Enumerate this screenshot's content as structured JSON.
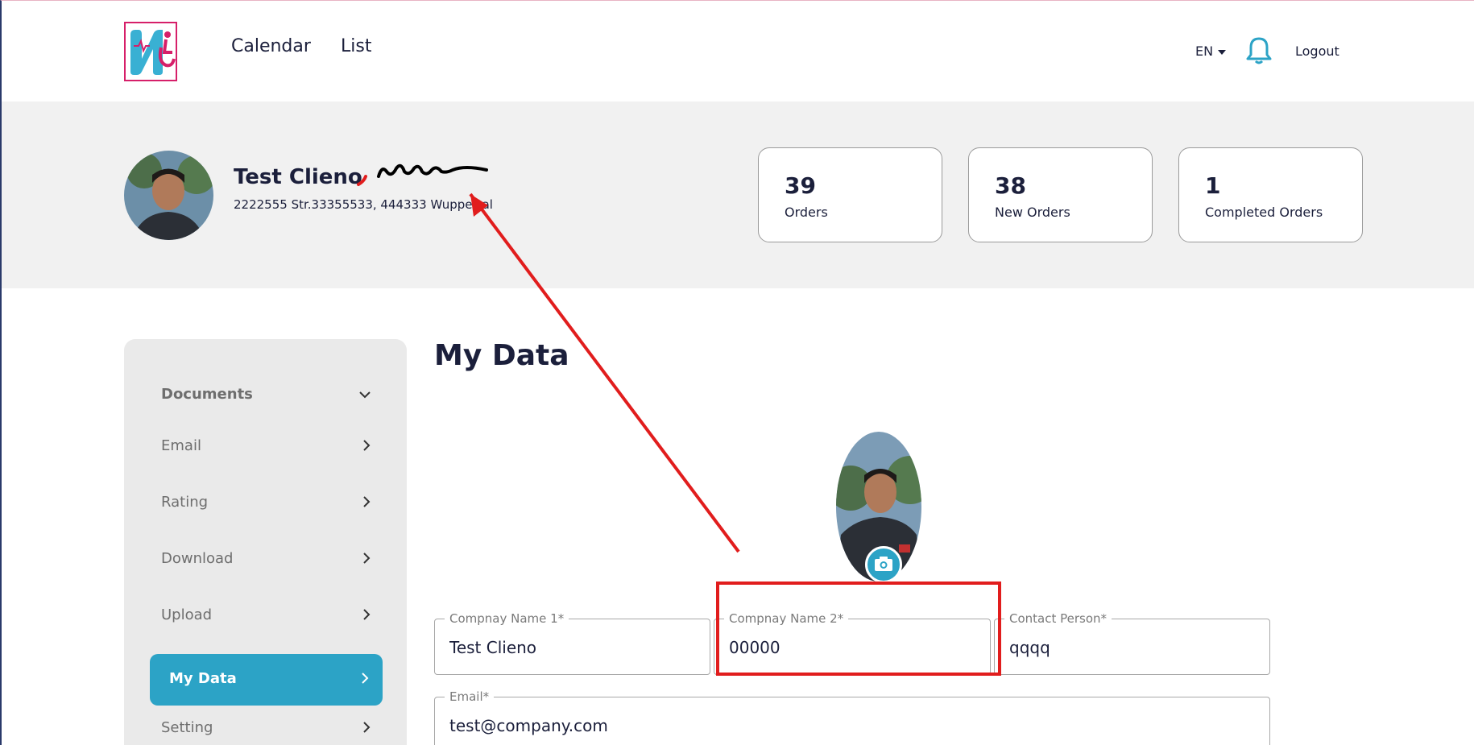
{
  "header": {
    "nav": [
      {
        "label": "Calendar"
      },
      {
        "label": "List"
      }
    ],
    "language": "EN",
    "logout_label": "Logout"
  },
  "profile": {
    "name": "Test Clieno",
    "address": "2222555 Str.33355533, 444333 Wuppertal"
  },
  "stats": [
    {
      "value": "39",
      "label": "Orders"
    },
    {
      "value": "38",
      "label": "New Orders"
    },
    {
      "value": "1",
      "label": "Completed Orders"
    }
  ],
  "sidebar": {
    "items": [
      {
        "label": "Documents",
        "chevron": "chevron-down"
      },
      {
        "label": "Email",
        "chevron": "chevron-right"
      },
      {
        "label": "Rating",
        "chevron": "chevron-right"
      },
      {
        "label": "Download",
        "chevron": "chevron-right"
      },
      {
        "label": "Upload",
        "chevron": "chevron-right"
      },
      {
        "label": "My Data",
        "chevron": "chevron-right",
        "active": true
      },
      {
        "label": "Setting",
        "chevron": "chevron-right"
      }
    ]
  },
  "main": {
    "title": "My Data",
    "fields": {
      "company1": {
        "label": "Compnay Name 1*",
        "value": "Test Clieno"
      },
      "company2": {
        "label": "Compnay Name 2*",
        "value": "00000"
      },
      "contact": {
        "label": "Contact Person*",
        "value": "qqqq"
      },
      "email": {
        "label": "Email*",
        "value": "test@company.com"
      }
    }
  },
  "colors": {
    "accent": "#2ca3c6",
    "brand_pink": "#d61f69",
    "annotation_red": "#e11d1d",
    "band_bg": "#f1f1f1"
  },
  "icons": [
    "logo-icon",
    "bell-icon",
    "chevron-down-icon",
    "chevron-right-icon",
    "camera-icon"
  ]
}
